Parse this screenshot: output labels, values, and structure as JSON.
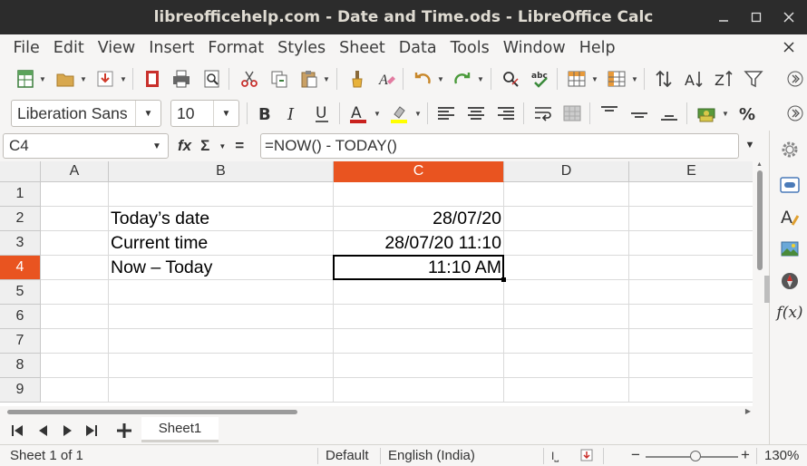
{
  "window": {
    "title": "libreofficehelp.com - Date and Time.ods - LibreOffice Calc"
  },
  "menu": {
    "items": [
      "File",
      "Edit",
      "View",
      "Insert",
      "Format",
      "Styles",
      "Sheet",
      "Data",
      "Tools",
      "Window",
      "Help"
    ]
  },
  "format_toolbar": {
    "font_name": "Liberation Sans",
    "font_size": "10"
  },
  "formula_bar": {
    "cell_ref": "C4",
    "fx_label": "fx",
    "sum_label": "Σ",
    "equals_label": "=",
    "formula": "=NOW() - TODAY()"
  },
  "grid": {
    "columns": [
      "A",
      "B",
      "C",
      "D",
      "E"
    ],
    "active_column": "C",
    "rows": [
      "1",
      "2",
      "3",
      "4",
      "5",
      "6",
      "7",
      "8",
      "9"
    ],
    "active_row": "4",
    "cells": {
      "B2": "Today’s date",
      "C2": "28/07/20",
      "B3": "Current time",
      "C3": "28/07/20 11:10",
      "B4": "Now – Today",
      "C4": "11:10 AM"
    }
  },
  "sheets": {
    "tabs": [
      "Sheet1"
    ],
    "active": "Sheet1"
  },
  "status": {
    "sheet_info": "Sheet 1 of 1",
    "page_style": "Default",
    "language": "English (India)",
    "zoom": "130%"
  },
  "sidebar": {
    "functions_label": "f(x)"
  },
  "colors": {
    "accent": "#e95420",
    "titlebar": "#2c2c2c"
  }
}
